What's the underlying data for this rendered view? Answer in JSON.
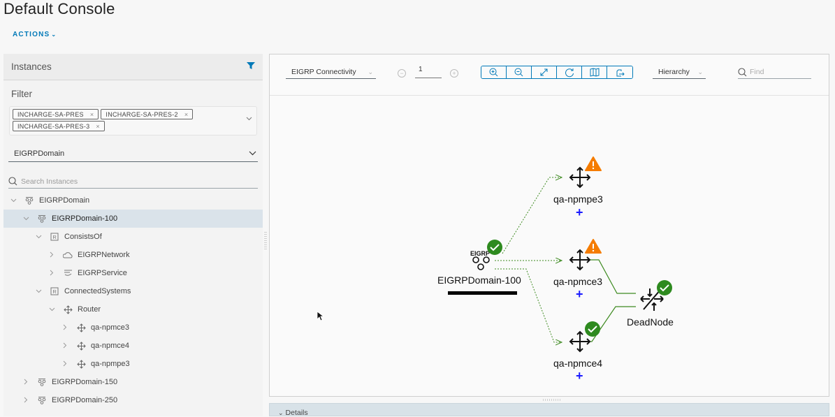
{
  "page": {
    "title": "Default Console",
    "actions_label": "ACTIONS"
  },
  "instances_panel": {
    "header": "Instances",
    "filter_icon": "filter-icon",
    "filter_label": "Filter",
    "filter_chips": [
      "INCHARGE-SA-PRES",
      "INCHARGE-SA-PRES-2",
      "INCHARGE-SA-PRES-3"
    ],
    "class_select": "EIGRPDomain",
    "search_placeholder": "Search Instances",
    "tree": [
      {
        "label": "EIGRPDomain",
        "level": 0,
        "expanded": true,
        "icon": "eigrp-domain-icon"
      },
      {
        "label": "EIGRPDomain-100",
        "level": 1,
        "expanded": true,
        "icon": "eigrp-domain-icon",
        "selected": true
      },
      {
        "label": "ConsistsOf",
        "level": 2,
        "expanded": true,
        "icon": "relationship-icon"
      },
      {
        "label": "EIGRPNetwork",
        "level": 3,
        "expanded": false,
        "icon": "network-cloud-icon"
      },
      {
        "label": "EIGRPService",
        "level": 3,
        "expanded": false,
        "icon": "service-icon"
      },
      {
        "label": "ConnectedSystems",
        "level": 2,
        "expanded": true,
        "icon": "relationship-icon"
      },
      {
        "label": "Router",
        "level": 3,
        "expanded": true,
        "icon": "router-icon"
      },
      {
        "label": "qa-npmce3",
        "level": 4,
        "expanded": false,
        "icon": "router-icon"
      },
      {
        "label": "qa-npmce4",
        "level": 4,
        "expanded": false,
        "icon": "router-icon"
      },
      {
        "label": "qa-npmpe3",
        "level": 4,
        "expanded": false,
        "icon": "router-icon"
      },
      {
        "label": "EIGRPDomain-150",
        "level": 1,
        "expanded": false,
        "icon": "eigrp-domain-icon"
      },
      {
        "label": "EIGRPDomain-250",
        "level": 1,
        "expanded": false,
        "icon": "eigrp-domain-icon"
      }
    ]
  },
  "map_toolbar": {
    "view_select": "EIGRP Connectivity",
    "hop_value": "1",
    "buttons": [
      "zoom-in",
      "zoom-out",
      "fit",
      "refresh",
      "map",
      "export"
    ],
    "layout_select": "Hierarchy",
    "find_placeholder": "Find"
  },
  "topology": {
    "nodes": [
      {
        "id": "domain",
        "label": "EIGRPDomain-100",
        "icon_text": "EIGRP",
        "status": "ok"
      },
      {
        "id": "pe3",
        "label": "qa-npmpe3",
        "status": "warning",
        "expandable": true
      },
      {
        "id": "ce3",
        "label": "qa-npmce3",
        "status": "warning",
        "expandable": true
      },
      {
        "id": "ce4",
        "label": "qa-npmce4",
        "status": "ok",
        "expandable": true
      },
      {
        "id": "dead",
        "label": "DeadNode",
        "status": "ok"
      }
    ],
    "colors": {
      "ok": "#2e8a1f",
      "warning": "#f57c00",
      "edge": "#3d8a20",
      "plus": "#1a1aff"
    }
  },
  "details": {
    "label": "Details"
  }
}
